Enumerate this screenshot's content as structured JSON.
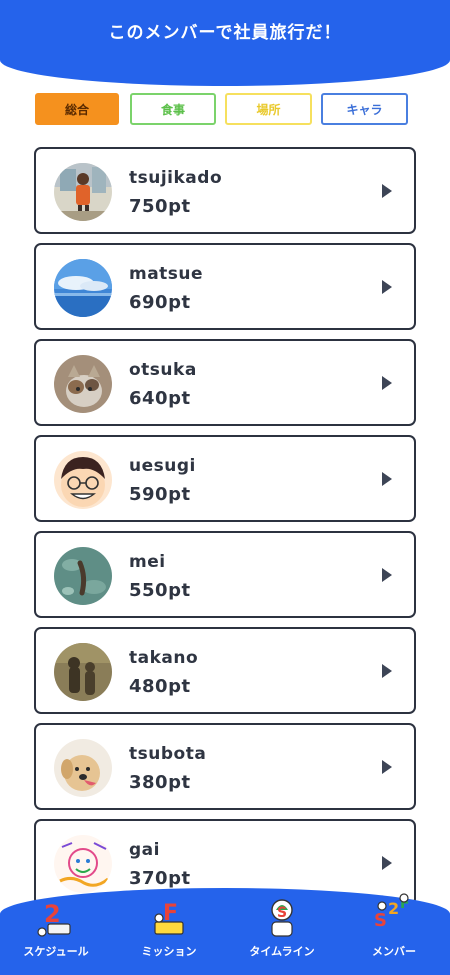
{
  "header": {
    "title": "このメンバーで社員旅行だ！"
  },
  "tabs": [
    {
      "label": "総合"
    },
    {
      "label": "食事"
    },
    {
      "label": "場所"
    },
    {
      "label": "キャラ"
    }
  ],
  "members": [
    {
      "name": "tsujikado",
      "points": "750pt",
      "avatar": "person-photo"
    },
    {
      "name": "matsue",
      "points": "690pt",
      "avatar": "sky-photo"
    },
    {
      "name": "otsuka",
      "points": "640pt",
      "avatar": "cat-photo"
    },
    {
      "name": "uesugi",
      "points": "590pt",
      "avatar": "cartoon-face"
    },
    {
      "name": "mei",
      "points": "550pt",
      "avatar": "water-photo"
    },
    {
      "name": "takano",
      "points": "480pt",
      "avatar": "shadow-photo"
    },
    {
      "name": "tsubota",
      "points": "380pt",
      "avatar": "dog-photo"
    },
    {
      "name": "gai",
      "points": "370pt",
      "avatar": "drawing"
    }
  ],
  "nav": [
    {
      "label": "スケジュール",
      "icon": "schedule-icon"
    },
    {
      "label": "ミッション",
      "icon": "mission-icon"
    },
    {
      "label": "タイムライン",
      "icon": "timeline-icon"
    },
    {
      "label": "メンバー",
      "icon": "member-icon"
    }
  ],
  "colors": {
    "primary": "#2563eb",
    "active_tab": "#f5911e",
    "text": "#2f3542"
  }
}
